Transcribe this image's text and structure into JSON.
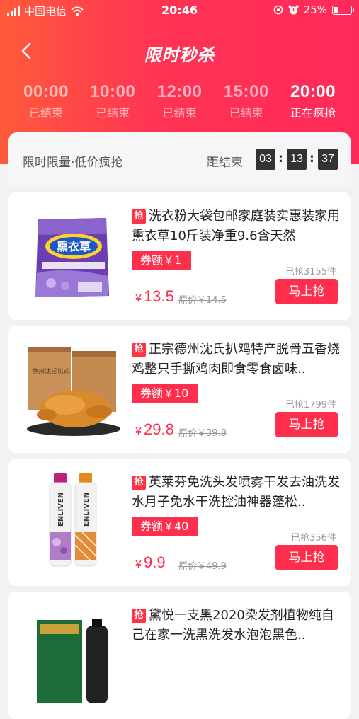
{
  "status_bar": {
    "carrier": "中国电信",
    "time": "20:46",
    "battery": "25%"
  },
  "header": {
    "title": "限时秒杀"
  },
  "slots": [
    {
      "time": "00:00",
      "status": "已结束"
    },
    {
      "time": "10:00",
      "status": "已结束"
    },
    {
      "time": "12:00",
      "status": "已结束"
    },
    {
      "time": "15:00",
      "status": "已结束"
    },
    {
      "time": "20:00",
      "status": "正在疯抢"
    }
  ],
  "countdown": {
    "label": "限时限量·低价疯抢",
    "end_label": "距结束",
    "h": "03",
    "m": "13",
    "s": "37",
    "sep": ":"
  },
  "products": [
    {
      "tag": "抢",
      "title": "洗衣粉大袋包邮家庭装实惠装家用熏衣草10斤装净重9.6含天然",
      "coupon": "券额￥1",
      "sold": "已抢3155件",
      "yen": "￥",
      "price": "13.5",
      "orig": "原价￥14.5",
      "buy": "马上抢"
    },
    {
      "tag": "抢",
      "title": "正宗德州沈氏扒鸡特产脱骨五香烧鸡整只手撕鸡肉即食零食卤味..",
      "coupon": "券额￥10",
      "sold": "已抢1799件",
      "yen": "￥",
      "price": "29.8",
      "orig": "原价￥39.8",
      "buy": "马上抢"
    },
    {
      "tag": "抢",
      "title": "英莱芬免洗头发喷雾干发去油洗发水月子免水干洗控油神器蓬松..",
      "coupon": "券额￥40",
      "sold": "已抢356件",
      "yen": "￥",
      "price": "9.9",
      "orig": "原价￥49.9",
      "buy": "马上抢"
    },
    {
      "tag": "抢",
      "title": "黛悦一支黑2020染发剂植物纯自己在家一洗黑洗发水泡泡黑色..",
      "coupon": "",
      "sold": "",
      "yen": "",
      "price": "",
      "orig": "",
      "buy": ""
    }
  ],
  "image_labels": {
    "lavender_brand": "熏衣草",
    "enliven": "ENLIVEN",
    "chicken": "德州沈氏扒鸡"
  },
  "colors": {
    "accent": "#ff2e4d",
    "gradient_start": "#ff5a3c",
    "gradient_end": "#ff2a5a"
  }
}
